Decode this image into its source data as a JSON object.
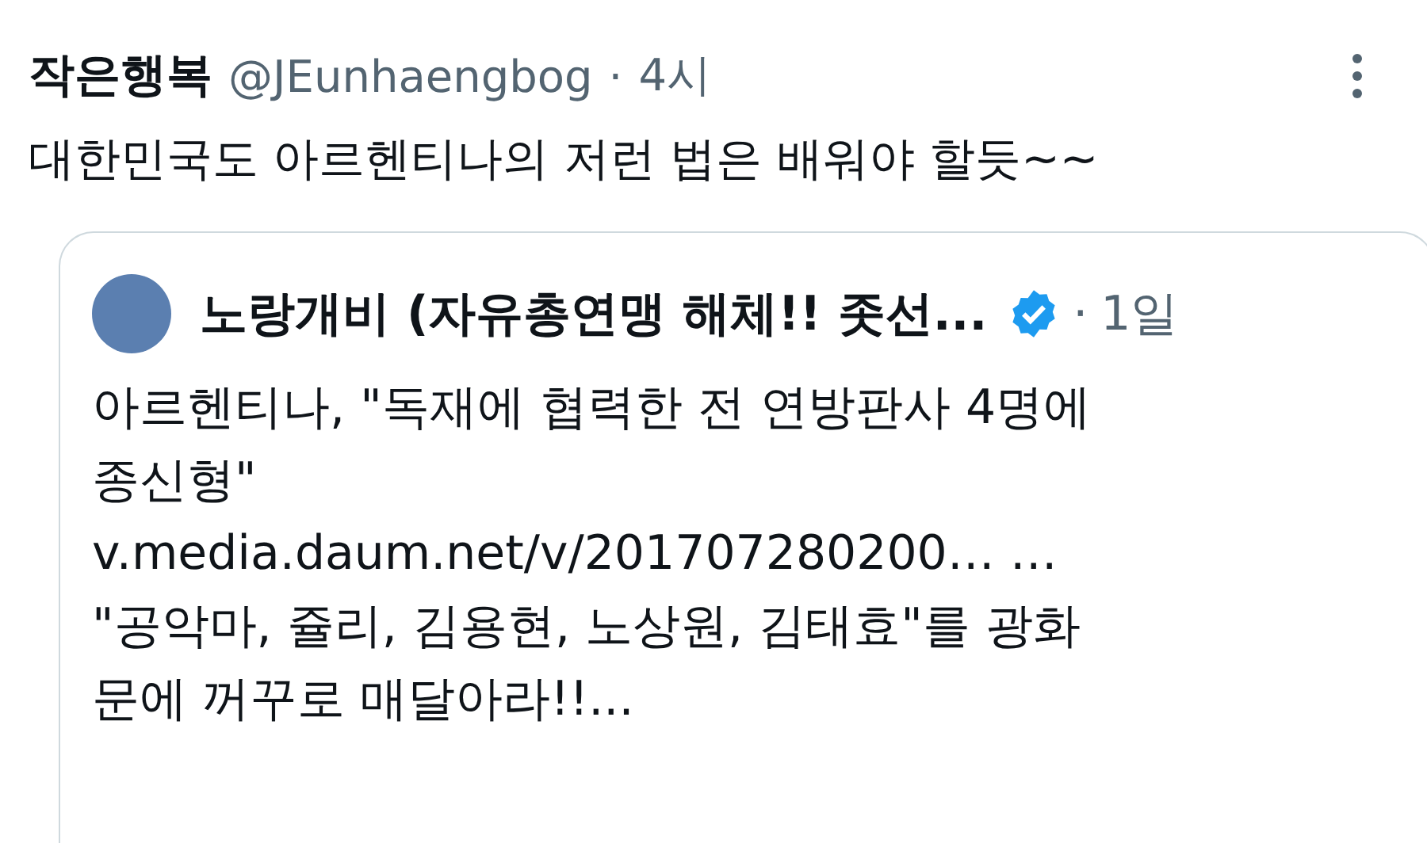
{
  "post": {
    "display_name": "작은행복",
    "handle": "@JEunhaengbog",
    "separator": "·",
    "time": "4시",
    "text": "대한민국도 아르헨티나의 저런 법은 배워야 할듯~~"
  },
  "quoted_post": {
    "display_name": "노랑개비 (자유총연맹 해체!! 좃선...",
    "verified": true,
    "separator": "·",
    "time": "1일",
    "body": [
      {
        "kind": "text",
        "text": "아르헨티나, \"독재에 협력한 전 연방판사 4명에 종신형\""
      },
      {
        "kind": "link",
        "text": "v.media.daum.net/v/201707280200… …"
      },
      {
        "kind": "text",
        "text": "\"공악마, 쥴리, 김용현, 노상원, 김태효\"를 광화문에 꺼꾸로 매달아라!!..."
      }
    ]
  }
}
